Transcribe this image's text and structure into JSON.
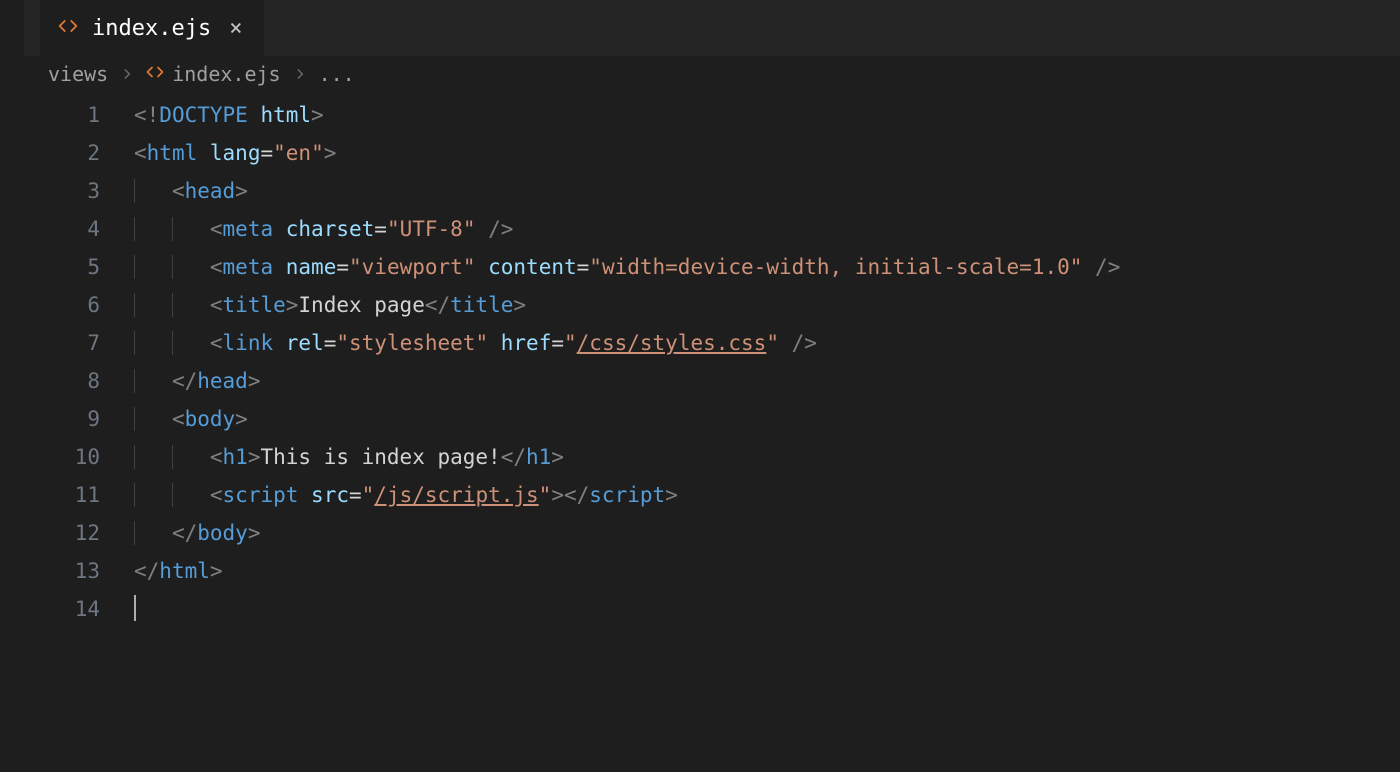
{
  "tab": {
    "filename": "index.ejs",
    "close_glyph": "×"
  },
  "breadcrumb": {
    "folder": "views",
    "file": "index.ejs",
    "rest": "..."
  },
  "line_numbers": [
    "1",
    "2",
    "3",
    "4",
    "5",
    "6",
    "7",
    "8",
    "9",
    "10",
    "11",
    "12",
    "13",
    "14"
  ],
  "code": {
    "l1": {
      "open": "<!",
      "doctype": "DOCTYPE",
      "sp": " ",
      "attr": "html",
      "close": ">"
    },
    "l2": {
      "open": "<",
      "tag": "html",
      "sp": " ",
      "attr": "lang",
      "eq": "=",
      "q": "\"",
      "val": "en",
      "close": ">"
    },
    "l3": {
      "open": "<",
      "tag": "head",
      "close": ">"
    },
    "l4": {
      "open": "<",
      "tag": "meta",
      "sp": " ",
      "attr": "charset",
      "eq": "=",
      "q": "\"",
      "val": "UTF-8",
      "close": " />"
    },
    "l5": {
      "open": "<",
      "tag": "meta",
      "sp": " ",
      "a1": "name",
      "eq": "=",
      "q": "\"",
      "v1": "viewport",
      "sp2": " ",
      "a2": "content",
      "v2": "width=device-width, initial-scale=1.0",
      "close": " />"
    },
    "l6": {
      "open": "<",
      "tag": "title",
      "close1": ">",
      "text": "Index page",
      "open2": "</",
      "close2": ">"
    },
    "l7": {
      "open": "<",
      "tag": "link",
      "sp": " ",
      "a1": "rel",
      "eq": "=",
      "q": "\"",
      "v1": "stylesheet",
      "sp2": " ",
      "a2": "href",
      "v2": "/css/styles.css",
      "close": " />"
    },
    "l8": {
      "open": "</",
      "tag": "head",
      "close": ">"
    },
    "l9": {
      "open": "<",
      "tag": "body",
      "close": ">"
    },
    "l10": {
      "open": "<",
      "tag": "h1",
      "close1": ">",
      "text": "This is index page!",
      "open2": "</",
      "close2": ">"
    },
    "l11": {
      "open": "<",
      "tag": "script",
      "sp": " ",
      "a1": "src",
      "eq": "=",
      "q": "\"",
      "v1": "/js/script.js",
      "close1": ">",
      "open2": "</",
      "close2": ">"
    },
    "l12": {
      "open": "</",
      "tag": "body",
      "close": ">"
    },
    "l13": {
      "open": "</",
      "tag": "html",
      "close": ">"
    }
  }
}
